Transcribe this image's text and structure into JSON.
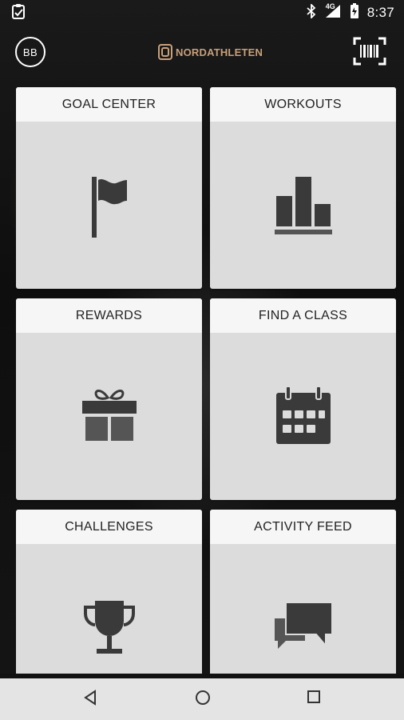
{
  "status_bar": {
    "time": "8:37",
    "network": "4G",
    "icons": [
      "notification-clipboard-icon",
      "bluetooth-icon",
      "signal-icon",
      "battery-icon"
    ]
  },
  "header": {
    "avatar_initials": "BB",
    "logo_text": "NORDATHLETEN",
    "scan_icon": "barcode-scan-icon"
  },
  "tiles": [
    {
      "label": "GOAL CENTER",
      "icon": "flag-icon"
    },
    {
      "label": "WORKOUTS",
      "icon": "bar-chart-icon"
    },
    {
      "label": "REWARDS",
      "icon": "gift-icon"
    },
    {
      "label": "FIND A CLASS",
      "icon": "calendar-icon"
    },
    {
      "label": "CHALLENGES",
      "icon": "trophy-icon"
    },
    {
      "label": "ACTIVITY FEED",
      "icon": "chat-bubbles-icon"
    }
  ],
  "nav_bar": {
    "icons": [
      "back-icon",
      "home-icon",
      "recents-icon"
    ]
  },
  "colors": {
    "tile_body": "#dcdcdc",
    "tile_header": "#f6f6f6",
    "icon": "#3a3a3a",
    "logo": "#c8a07a"
  }
}
